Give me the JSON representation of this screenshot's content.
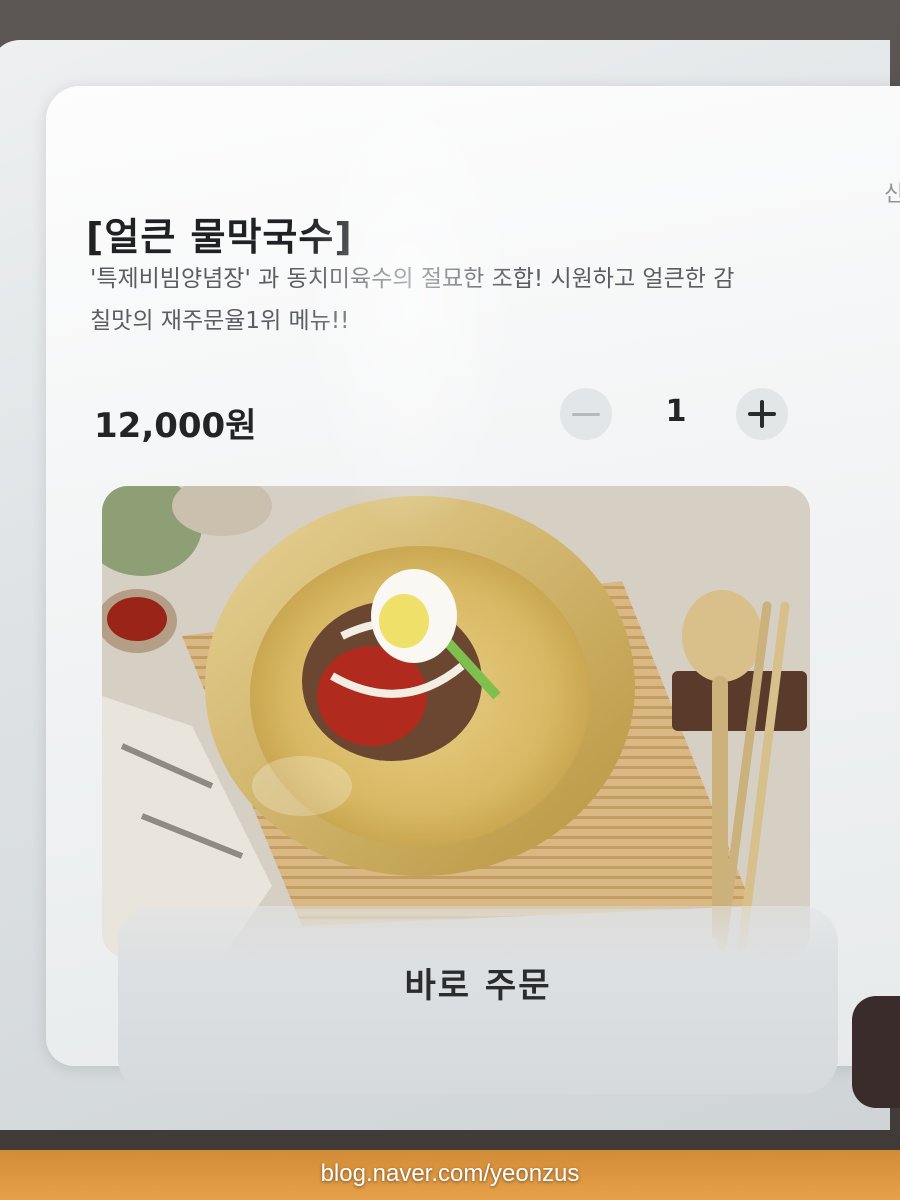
{
  "item": {
    "title": "[얼큰 물막국수]",
    "description_line1": "'특제비빔양념장' 과 동치미육수의 절묘한 조합! 시원하고 얼큰한 감",
    "description_line2": "칠맛의 재주문율1위 메뉴!!",
    "price": "12,000원"
  },
  "quantity": {
    "value": "1",
    "decrease_icon": "minus-icon",
    "increase_icon": "plus-icon"
  },
  "photo": {
    "subject": "naengmyeon-bowl-photo"
  },
  "actions": {
    "order_now_label": "바로 주문"
  },
  "partial_edge_text": "신",
  "watermark": "blog.naver.com/yeonzus",
  "colors": {
    "sheet_background": "#f4f5f6",
    "title_text": "#202124",
    "secondary_text": "#5a5e61",
    "order_button": "#dcdfe1",
    "side_button": "#3a2c2a"
  }
}
